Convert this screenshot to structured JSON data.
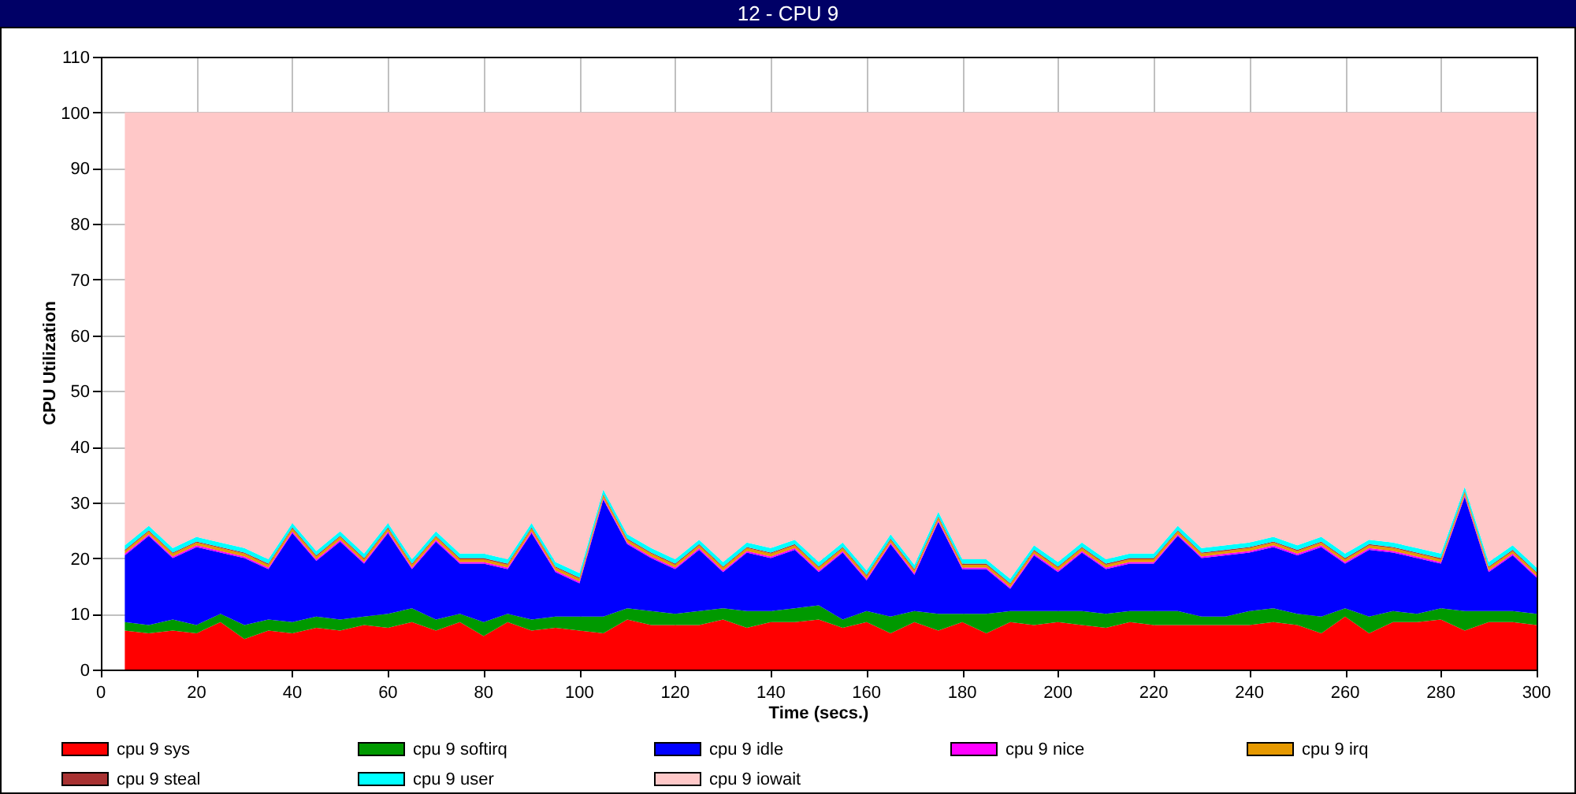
{
  "window": {
    "title": "12 - CPU 9"
  },
  "chart": {
    "chart_data": {
      "type": "area",
      "stacked": true,
      "grid": true,
      "xlabel": "Time (secs.)",
      "ylabel": "CPU Utilization",
      "x": [
        5,
        10,
        15,
        20,
        25,
        30,
        35,
        40,
        45,
        50,
        55,
        60,
        65,
        70,
        75,
        80,
        85,
        90,
        95,
        100,
        105,
        110,
        115,
        120,
        125,
        130,
        135,
        140,
        145,
        150,
        155,
        160,
        165,
        170,
        175,
        180,
        185,
        190,
        195,
        200,
        205,
        210,
        215,
        220,
        225,
        230,
        235,
        240,
        245,
        250,
        255,
        260,
        265,
        270,
        275,
        280,
        285,
        290,
        295,
        300
      ],
      "xlim": [
        0,
        300
      ],
      "ylim": [
        0,
        110
      ],
      "xticks": [
        0,
        20,
        40,
        60,
        80,
        100,
        120,
        140,
        160,
        180,
        200,
        220,
        240,
        260,
        280,
        300
      ],
      "yticks": [
        0,
        10,
        20,
        30,
        40,
        50,
        60,
        70,
        80,
        90,
        100,
        110
      ],
      "series": [
        {
          "name": "cpu 9 sys",
          "color": "#ff0000",
          "values": [
            7,
            6.5,
            7,
            6.5,
            8.5,
            5.5,
            7,
            6.5,
            7.5,
            7,
            8,
            7.5,
            8.5,
            7,
            8.5,
            6,
            8.5,
            7,
            7.5,
            7,
            6.5,
            9,
            8,
            8,
            8,
            9,
            7.5,
            8.5,
            8.5,
            9,
            7.5,
            8.5,
            6.5,
            8.5,
            7,
            8.5,
            6.5,
            8.5,
            8,
            8.5,
            8,
            7.5,
            8.5,
            8,
            8,
            8,
            8,
            8,
            8.5,
            8,
            6.5,
            9.5,
            6.5,
            8.5,
            8.5,
            9,
            7,
            8.5,
            8.5,
            8
          ]
        },
        {
          "name": "cpu 9 softirq",
          "color": "#009900",
          "values": [
            1.5,
            1.5,
            2,
            1.5,
            1.5,
            2.5,
            2,
            2,
            2,
            2,
            1.5,
            2.5,
            2.5,
            2,
            1.5,
            2.5,
            1.5,
            2,
            2,
            2.5,
            3,
            2,
            2.5,
            2,
            2.5,
            2,
            3,
            2,
            2.5,
            2.5,
            1.5,
            2,
            3,
            2,
            3,
            1.5,
            3.5,
            2,
            2.5,
            2,
            2.5,
            2.5,
            2,
            2.5,
            2.5,
            1.5,
            1.5,
            2.5,
            2.5,
            2,
            3,
            1.5,
            3,
            2,
            1.5,
            2,
            3.5,
            2,
            2,
            2
          ]
        },
        {
          "name": "cpu 9 idle",
          "color": "#0000ff",
          "values": [
            12,
            16,
            11,
            14,
            11,
            12,
            9,
            16,
            10,
            14,
            9.5,
            14.5,
            7,
            14,
            9,
            10.5,
            8,
            15.5,
            8,
            6,
            21,
            11.5,
            9.5,
            8,
            11,
            6.5,
            10.5,
            9.5,
            10.5,
            6,
            12,
            5.5,
            13,
            6.5,
            16.5,
            8,
            8,
            4,
            10,
            7,
            10.5,
            8,
            8.5,
            8.5,
            13.5,
            10.5,
            11,
            10.5,
            11,
            10.5,
            12.5,
            8,
            12,
            10.5,
            10,
            8,
            20.5,
            7,
            10,
            6.5
          ]
        },
        {
          "name": "cpu 9 nice",
          "color": "#ff00ff",
          "values": [
            0.3,
            0.3,
            0.3,
            0.3,
            0.3,
            0.3,
            0.3,
            0.3,
            0.3,
            0.3,
            0.3,
            0.3,
            0.3,
            0.3,
            0.3,
            0.3,
            0.3,
            0.3,
            0.3,
            0.3,
            0.3,
            0.3,
            0.3,
            0.3,
            0.3,
            0.3,
            0.3,
            0.3,
            0.3,
            0.3,
            0.3,
            0.3,
            0.3,
            0.3,
            0.3,
            0.3,
            0.3,
            0.3,
            0.3,
            0.3,
            0.3,
            0.3,
            0.3,
            0.3,
            0.3,
            0.3,
            0.3,
            0.3,
            0.3,
            0.3,
            0.3,
            0.3,
            0.3,
            0.3,
            0.3,
            0.3,
            0.3,
            0.3,
            0.3,
            0.3
          ]
        },
        {
          "name": "cpu 9 irq",
          "color": "#e69900",
          "values": [
            0.5,
            0.5,
            0.5,
            0.5,
            0.5,
            0.5,
            0.5,
            0.5,
            0.5,
            0.5,
            0.5,
            0.5,
            0.5,
            0.5,
            0.5,
            0.5,
            0.5,
            0.5,
            0.5,
            0.5,
            0.5,
            0.5,
            0.5,
            0.5,
            0.5,
            0.5,
            0.5,
            0.5,
            0.5,
            0.5,
            0.5,
            0.5,
            0.5,
            0.5,
            0.5,
            0.5,
            0.5,
            0.5,
            0.5,
            0.5,
            0.5,
            0.5,
            0.5,
            0.5,
            0.5,
            0.5,
            0.5,
            0.5,
            0.5,
            0.5,
            0.5,
            0.5,
            0.5,
            0.5,
            0.5,
            0.5,
            0.5,
            0.5,
            0.5,
            0.5
          ]
        },
        {
          "name": "cpu 9 steal",
          "color": "#a83232",
          "values": [
            0.2,
            0.2,
            0.2,
            0.2,
            0.2,
            0.2,
            0.2,
            0.2,
            0.2,
            0.2,
            0.2,
            0.2,
            0.2,
            0.2,
            0.2,
            0.2,
            0.2,
            0.2,
            0.2,
            0.2,
            0.2,
            0.2,
            0.2,
            0.2,
            0.2,
            0.2,
            0.2,
            0.2,
            0.2,
            0.2,
            0.2,
            0.2,
            0.2,
            0.2,
            0.2,
            0.2,
            0.2,
            0.2,
            0.2,
            0.2,
            0.2,
            0.2,
            0.2,
            0.2,
            0.2,
            0.2,
            0.2,
            0.2,
            0.2,
            0.2,
            0.2,
            0.2,
            0.2,
            0.2,
            0.2,
            0.2,
            0.2,
            0.2,
            0.2,
            0.2
          ]
        },
        {
          "name": "cpu 9 user",
          "color": "#00ffff",
          "values": [
            0.8,
            0.8,
            0.8,
            0.8,
            0.8,
            0.8,
            0.8,
            0.8,
            0.8,
            0.8,
            0.8,
            0.8,
            0.8,
            0.8,
            0.8,
            0.8,
            0.8,
            0.8,
            0.8,
            0.8,
            0.8,
            0.8,
            0.8,
            0.8,
            0.8,
            0.8,
            0.8,
            0.8,
            0.8,
            0.8,
            0.8,
            0.8,
            0.8,
            0.8,
            0.8,
            0.8,
            0.8,
            0.8,
            0.8,
            0.8,
            0.8,
            0.8,
            0.8,
            0.8,
            0.8,
            0.8,
            0.8,
            0.8,
            0.8,
            0.8,
            0.8,
            0.8,
            0.8,
            0.8,
            0.8,
            0.8,
            0.8,
            0.8,
            0.8,
            0.8
          ]
        },
        {
          "name": "cpu 9 iowait",
          "color": "#ffc8c8",
          "values": [
            77.7,
            74.2,
            78.2,
            76.2,
            77.2,
            78.2,
            80.2,
            73.7,
            78.7,
            75.2,
            79.2,
            73.7,
            80.2,
            75.2,
            79.2,
            79.2,
            80.2,
            73.7,
            80.7,
            82.7,
            67.7,
            75.7,
            78.2,
            80.2,
            76.7,
            80.7,
            77.2,
            78.2,
            76.7,
            80.7,
            77.2,
            82.2,
            75.7,
            81.2,
            71.7,
            80.2,
            80.2,
            83.7,
            77.7,
            80.7,
            77.2,
            80.2,
            79.2,
            79.2,
            74.2,
            78.2,
            77.7,
            77.2,
            76.2,
            77.7,
            76.2,
            79.2,
            76.7,
            77.2,
            78.2,
            79.2,
            67.2,
            80.7,
            77.7,
            81.7
          ]
        }
      ]
    }
  }
}
